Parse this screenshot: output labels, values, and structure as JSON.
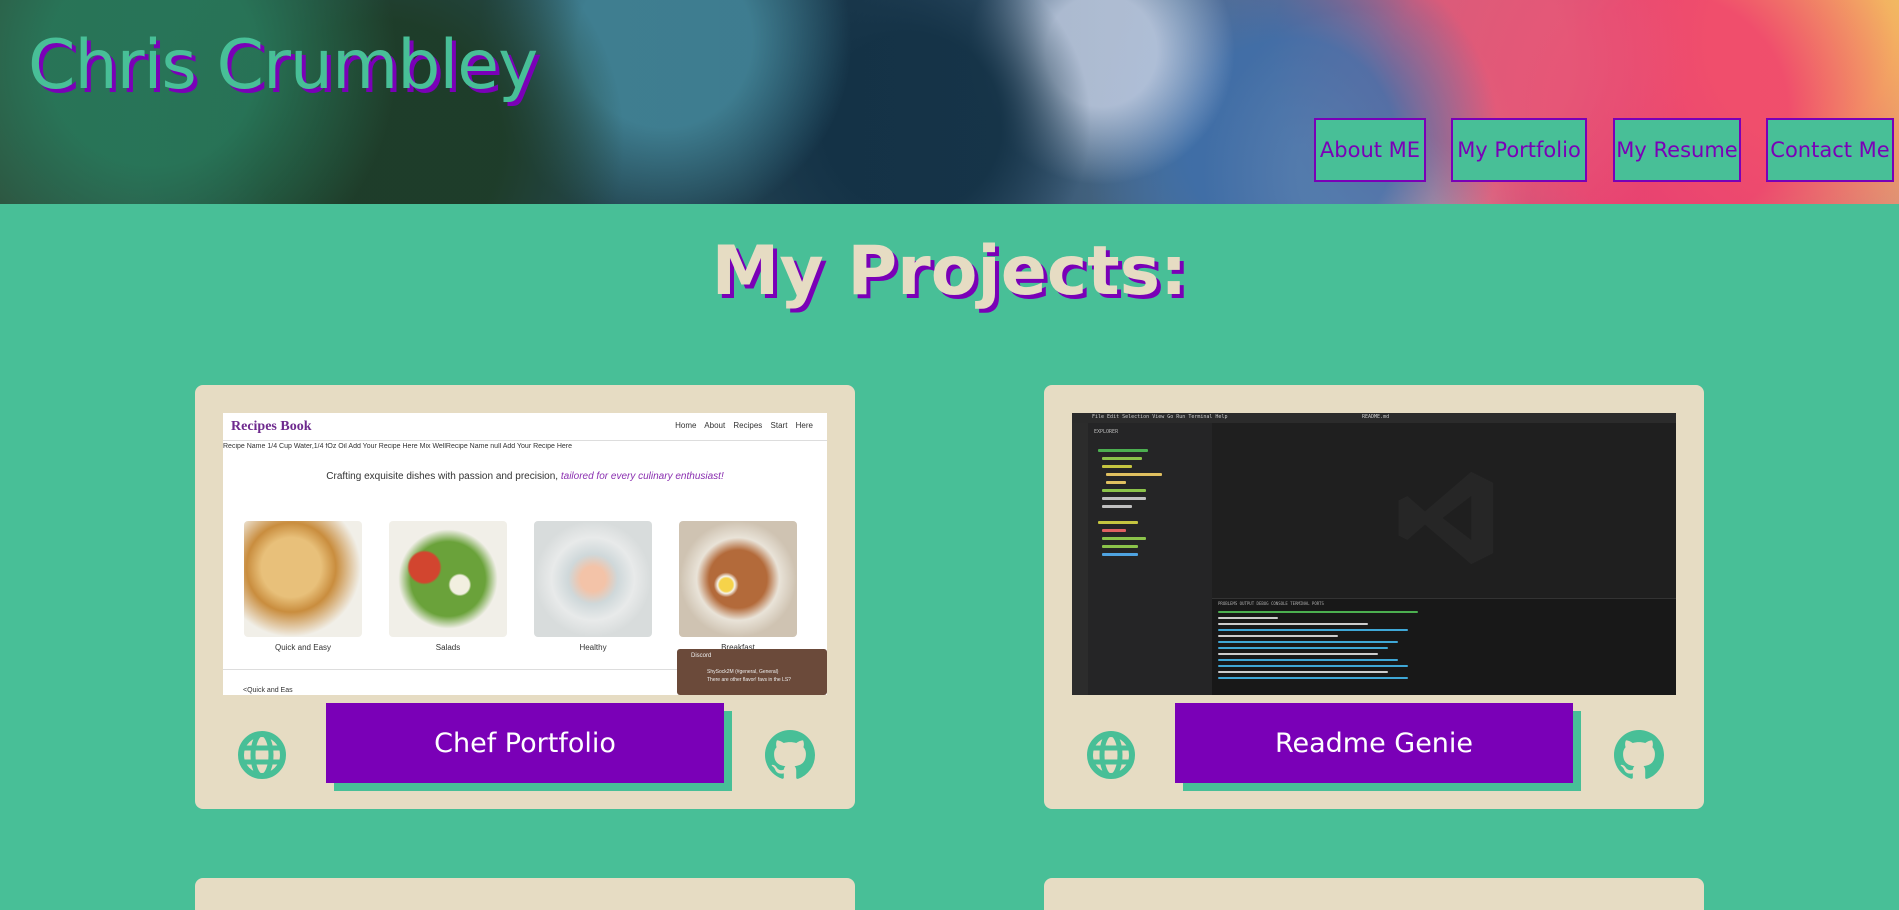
{
  "header": {
    "site_title": "Chris Crumbley",
    "nav": [
      "About ME",
      "My Portfolio",
      "My Resume",
      "Contact Me"
    ]
  },
  "main": {
    "heading": "My Projects:",
    "projects": [
      {
        "title": "Chef Portfolio",
        "screenshot": {
          "logo": "Recipes Book",
          "nav": "Home About Recipes Start Here",
          "recipe_line": "Recipe Name 1/4 Cup Water,1/4 fOz Oil Add Your Recipe Here Mix WellRecipe Name null Add Your Recipe Here",
          "tagline_plain": "Crafting exquisite dishes with passion and precision, ",
          "tagline_em": "tailored for every culinary enthusiast!",
          "categories": [
            "Quick and Easy",
            "Salads",
            "Healthy",
            "Breakfast"
          ],
          "lower_label": "<Quick and Eas",
          "toast_title": "Discord",
          "toast_line1": "ShySock2M (#general, General)",
          "toast_line2": "There are other flavor! favs in the LS?"
        }
      },
      {
        "title": "Readme Genie",
        "screenshot": {
          "menu": "File  Edit  Selection  View  Go  Run  Terminal  Help",
          "search": "README.md",
          "explorer_title": "EXPLORER",
          "tabs": "PROBLEMS  OUTPUT  DEBUG CONSOLE  TERMINAL  PORTS"
        }
      }
    ]
  },
  "colors": {
    "background": "#48bf97",
    "accent": "#7a00b7",
    "card": "#e6dcc3",
    "heading": "#e6dcc3"
  },
  "icons": [
    "globe-icon",
    "github-icon"
  ]
}
